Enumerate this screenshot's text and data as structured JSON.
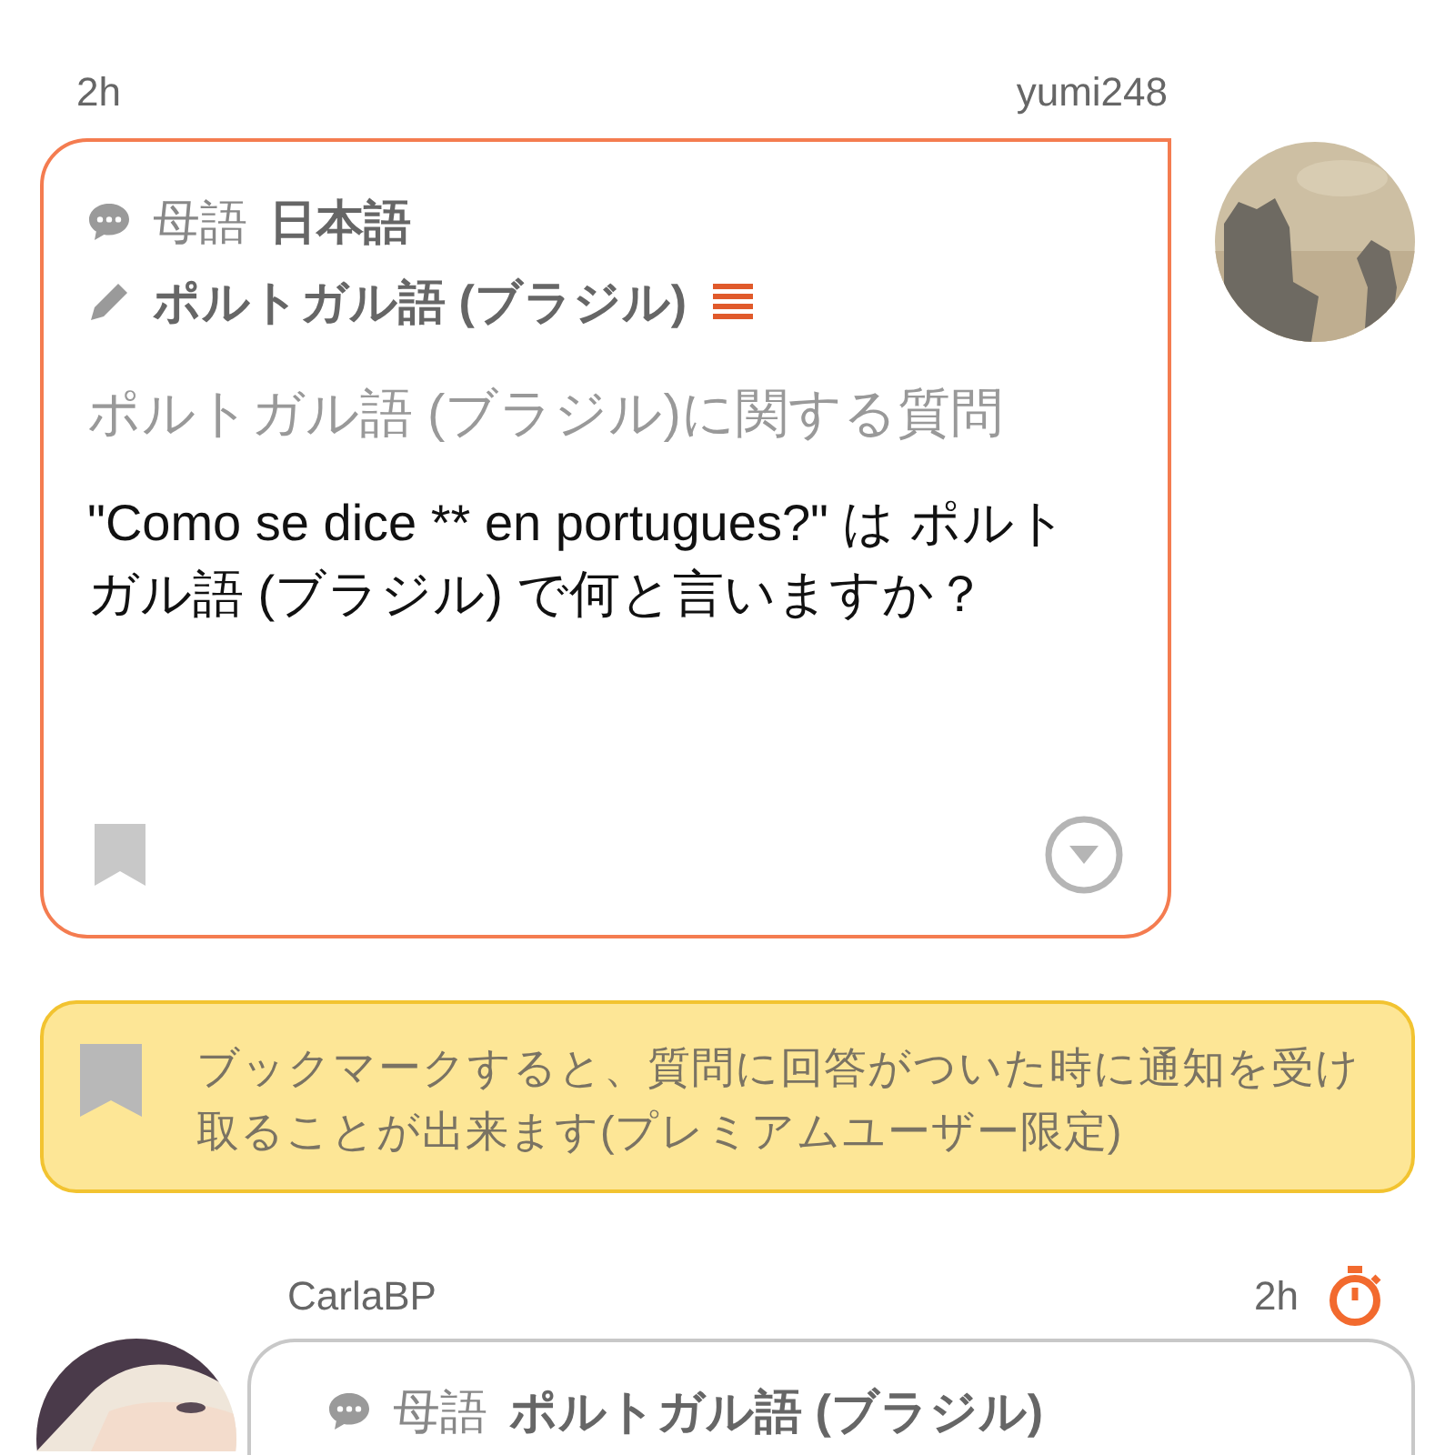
{
  "question": {
    "time": "2h",
    "user": "yumi248",
    "native_label": "母語",
    "native_language": "日本語",
    "learning_language": "ポルトガル語 (ブラジル)",
    "question_type": "ポルトガル語 (ブラジル)に関する質問",
    "text": "\"Como se dice ** en portugues?\" は ポルトガル語 (ブラジル) で何と言いますか？",
    "bookmarked": false
  },
  "notice": {
    "text": "ブックマークすると、質問に回答がついた時に通知を受け取ることが出来ます(プレミアムユーザー限定)"
  },
  "answer": {
    "user": "CarlaBP",
    "time": "2h",
    "native_label": "母語",
    "native_language": "ポルトガル語 (ブラジル)"
  }
}
